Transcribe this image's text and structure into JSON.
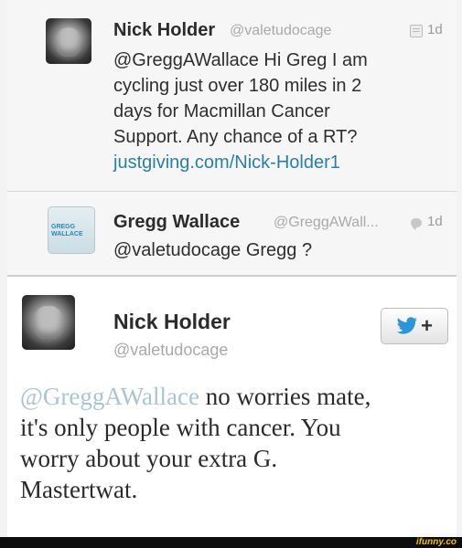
{
  "tweets": [
    {
      "name": "Nick Holder",
      "handle": "@valetudocage",
      "time": "1d",
      "text_lines": [
        "@GreggAWallace Hi Greg I am",
        "cycling just over 180 miles in 2",
        "days for Macmillan Cancer",
        "Support.  Any chance of a RT?"
      ],
      "link": "justgiving.com/Nick-Holder1"
    },
    {
      "name": "Gregg Wallace",
      "handle": "@GreggAWall...",
      "time": "1d",
      "text": "@valetudocage Gregg ?",
      "avatar_text_lines": [
        "GREGG",
        "WALLACE"
      ]
    },
    {
      "name": "Nick Holder",
      "handle": "@valetudocage",
      "follow_label": "+",
      "mention": "@GreggAWallace",
      "text_line1_rest": " no worries mate,",
      "text_lines": [
        "it's only people with cancer. You",
        "worry about your extra G.",
        "Mastertwat."
      ]
    }
  ],
  "watermark": "ifunny.co",
  "colors": {
    "link": "#2a7fa8",
    "twitter_blue": "#2b95d6",
    "watermark": "#f2c200"
  },
  "icons": {
    "tweet1_time_icon": "list-icon",
    "tweet2_time_icon": "speech-bubble-icon",
    "follow_icon": "twitter-bird-icon"
  }
}
